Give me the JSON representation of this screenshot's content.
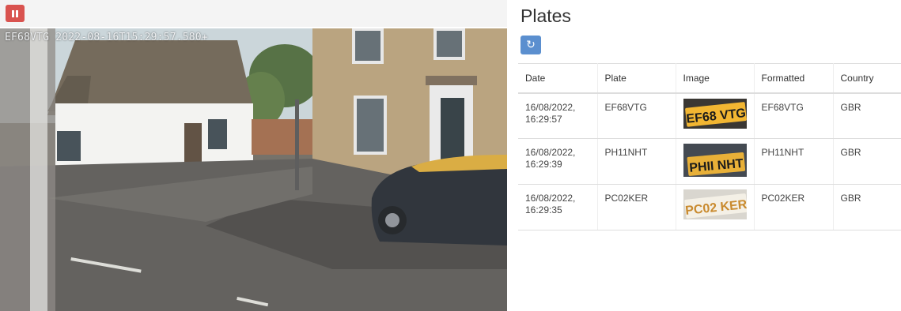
{
  "camera": {
    "overlay_text": "EF68VTG 2022-08-16T15:29:57.580+",
    "pause_icon": "pause-icon"
  },
  "plates": {
    "title": "Plates",
    "refresh_icon": "refresh-icon",
    "refresh_glyph": "↻",
    "columns": [
      "Date",
      "Plate",
      "Image",
      "Formatted",
      "Country"
    ],
    "rows": [
      {
        "date_line1": "16/08/2022,",
        "date_line2": "16:29:57",
        "plate": "EF68VTG",
        "image_text": "EF68 VTG",
        "formatted": "EF68VTG",
        "country": "GBR"
      },
      {
        "date_line1": "16/08/2022,",
        "date_line2": "16:29:39",
        "plate": "PH11NHT",
        "image_text": "PHII NHT",
        "formatted": "PH11NHT",
        "country": "GBR"
      },
      {
        "date_line1": "16/08/2022,",
        "date_line2": "16:29:35",
        "plate": "PC02KER",
        "image_text": "PC02 KER",
        "formatted": "PC02KER",
        "country": "GBR"
      }
    ]
  },
  "colors": {
    "pause_button": "#d9534f",
    "refresh_button": "#5b8fcf",
    "plate_yellow": "#f2b632",
    "plate_white": "#f4f0e6"
  }
}
